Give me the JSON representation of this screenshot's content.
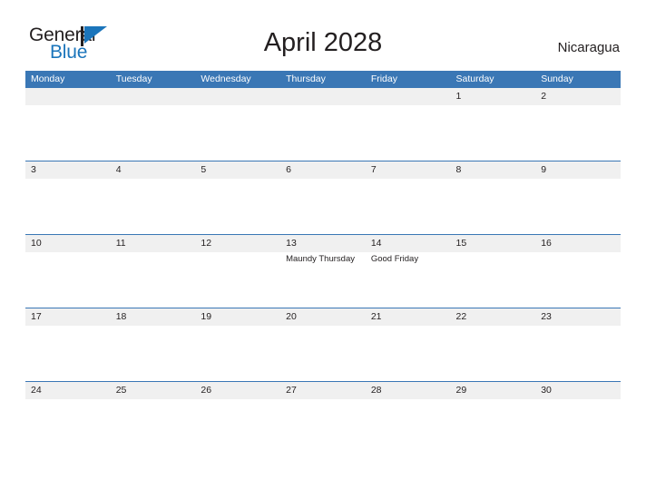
{
  "brand": {
    "name_part1": "General",
    "name_part2": "Blue",
    "mark": "triangle-flag-icon",
    "color_dark": "#231f20",
    "color_blue": "#1b75bb"
  },
  "header": {
    "title": "April 2028",
    "region": "Nicaragua"
  },
  "theme": {
    "header_blue": "#3a77b5",
    "band_grey": "#f0f0f0",
    "text": "#231f20",
    "page_background": "#ffffff"
  },
  "calendar": {
    "month": "April",
    "year": "2028",
    "weekday_headers": [
      "Monday",
      "Tuesday",
      "Wednesday",
      "Thursday",
      "Friday",
      "Saturday",
      "Sunday"
    ],
    "weeks": [
      {
        "days": [
          {
            "number": "",
            "event": ""
          },
          {
            "number": "",
            "event": ""
          },
          {
            "number": "",
            "event": ""
          },
          {
            "number": "",
            "event": ""
          },
          {
            "number": "",
            "event": ""
          },
          {
            "number": "1",
            "event": ""
          },
          {
            "number": "2",
            "event": ""
          }
        ]
      },
      {
        "days": [
          {
            "number": "3",
            "event": ""
          },
          {
            "number": "4",
            "event": ""
          },
          {
            "number": "5",
            "event": ""
          },
          {
            "number": "6",
            "event": ""
          },
          {
            "number": "7",
            "event": ""
          },
          {
            "number": "8",
            "event": ""
          },
          {
            "number": "9",
            "event": ""
          }
        ]
      },
      {
        "days": [
          {
            "number": "10",
            "event": ""
          },
          {
            "number": "11",
            "event": ""
          },
          {
            "number": "12",
            "event": ""
          },
          {
            "number": "13",
            "event": "Maundy Thursday"
          },
          {
            "number": "14",
            "event": "Good Friday"
          },
          {
            "number": "15",
            "event": ""
          },
          {
            "number": "16",
            "event": ""
          }
        ]
      },
      {
        "days": [
          {
            "number": "17",
            "event": ""
          },
          {
            "number": "18",
            "event": ""
          },
          {
            "number": "19",
            "event": ""
          },
          {
            "number": "20",
            "event": ""
          },
          {
            "number": "21",
            "event": ""
          },
          {
            "number": "22",
            "event": ""
          },
          {
            "number": "23",
            "event": ""
          }
        ]
      },
      {
        "days": [
          {
            "number": "24",
            "event": ""
          },
          {
            "number": "25",
            "event": ""
          },
          {
            "number": "26",
            "event": ""
          },
          {
            "number": "27",
            "event": ""
          },
          {
            "number": "28",
            "event": ""
          },
          {
            "number": "29",
            "event": ""
          },
          {
            "number": "30",
            "event": ""
          }
        ]
      }
    ]
  }
}
